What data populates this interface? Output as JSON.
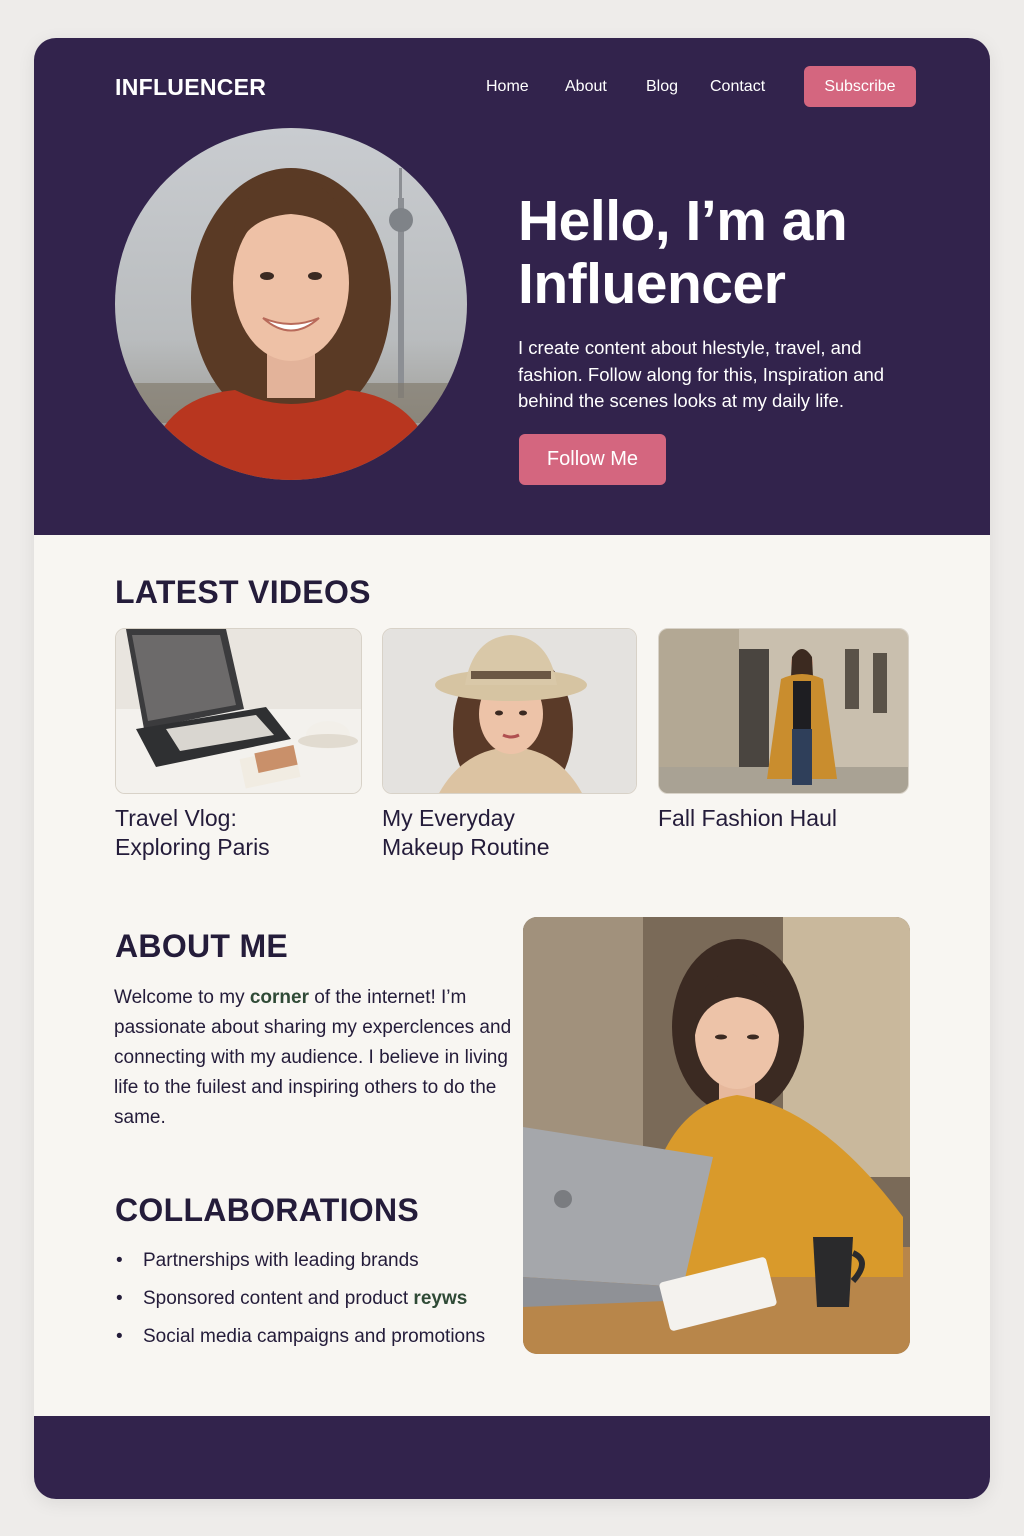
{
  "site": {
    "logo": "INFLUENCER"
  },
  "nav": {
    "items": [
      {
        "label": "Home"
      },
      {
        "label": "About"
      },
      {
        "label": "Blog"
      },
      {
        "label": "Contact"
      }
    ],
    "subscribe_label": "Subscribe"
  },
  "hero": {
    "title_line1": "Hello, I’m an",
    "title_line2": "Influencer",
    "description": "I create content about hlestyle, travel, and fashion. Follow along for this, Inspiration and behind the scenes looks at my daily life.",
    "cta_label": "Follow Me",
    "image": "portrait-photo"
  },
  "latest_videos": {
    "title": "LATEST VIDEOS",
    "items": [
      {
        "title_line1": "Travel Vlog:",
        "title_line2": "Exploring Paris",
        "image": "suitcase-photo"
      },
      {
        "title_line1": "My Everyday",
        "title_line2": "Makeup Routine",
        "image": "hat-portrait-photo"
      },
      {
        "title_line1": "Fall Fashion Haul",
        "title_line2": "",
        "image": "street-fashion-photo"
      }
    ]
  },
  "about": {
    "title": "ABOUT ME",
    "text_part1": "Welcome to my ",
    "highlight": "corner",
    "text_part2": " of the internet! I’m passionate about sharing my experc­lences and connecting with my audience. I believe in living life to the fuilest and inspiring others to do the same.",
    "image": "laptop-photo"
  },
  "collaborations": {
    "title": "COLLABORATIONS",
    "items": [
      {
        "text": "Partnerships with leading brands",
        "highlight": ""
      },
      {
        "text": "Sponsored content and product ",
        "highlight": "reyws"
      },
      {
        "text": "Social media campaigns and promotions",
        "highlight": ""
      }
    ]
  },
  "colors": {
    "primary": "#32234c",
    "accent": "#d4667f",
    "background": "#f8f6f2",
    "heading": "#241c3a",
    "highlight": "#2f4a36"
  }
}
